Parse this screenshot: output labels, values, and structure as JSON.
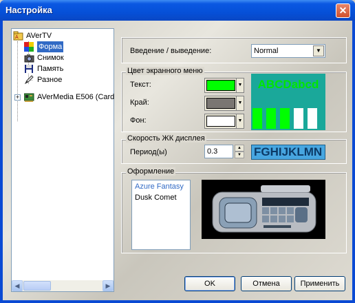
{
  "window": {
    "title": "Настройка",
    "close_glyph": "✕"
  },
  "tree": {
    "items": [
      {
        "label": "AVerTV",
        "icon": "avertv-folder-icon"
      },
      {
        "label": "Форма",
        "icon": "skin-form-icon",
        "selected": true
      },
      {
        "label": "Снимок",
        "icon": "camera-icon"
      },
      {
        "label": "Память",
        "icon": "floppy-disk-icon"
      },
      {
        "label": "Разное",
        "icon": "misc-pencil-icon"
      },
      {
        "label": "AVerMedia E506 (Card",
        "icon": "tv-card-icon",
        "expander": "+"
      }
    ],
    "scroll_left": "◀",
    "scroll_right": "▶"
  },
  "input_output": {
    "label": "Введение / выведение:",
    "value": "Normal"
  },
  "osd_colors": {
    "group_title": "Цвет экранного меню",
    "text_label": "Текст:",
    "edge_label": "Край:",
    "bg_label": "Фон:",
    "text_color": "#00ff00",
    "edge_color": "#7a7672",
    "bg_color": "#ffffff",
    "preview_text": "ABCDabcd",
    "preview_bg": "#1aa89a"
  },
  "lcd_speed": {
    "group_title": "Скорость ЖК дисплея",
    "period_label": "Период(ы)",
    "period_value": "0.3",
    "preview_text": "FGHIJKLMN"
  },
  "appearance": {
    "group_title": "Оформление",
    "skins": [
      "Azure Fantasy",
      "Dusk Comet"
    ],
    "selected_skin": "Azure Fantasy"
  },
  "buttons": {
    "ok": "OK",
    "cancel": "Отмена",
    "apply": "Применить"
  }
}
